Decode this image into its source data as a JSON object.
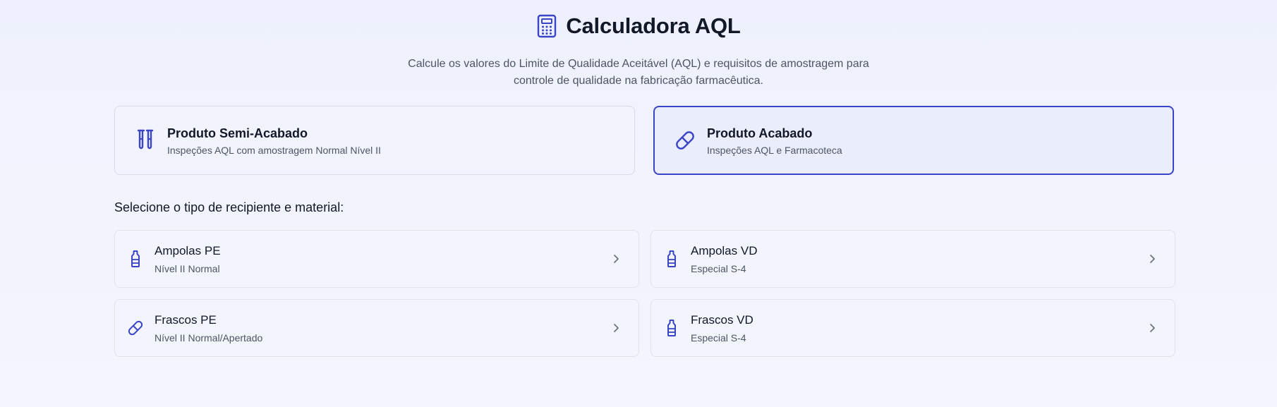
{
  "header": {
    "title": "Calculadora AQL",
    "title_icon": "calculator-icon",
    "subtitle": "Calcule os valores do Limite de Qualidade Aceitável (AQL) e requisitos de amostragem para controle de qualidade na fabricação farmacêutica."
  },
  "modes": [
    {
      "title": "Produto Semi-Acabado",
      "description": "Inspeções AQL com amostragem Normal Nível II",
      "icon": "test-tubes-icon",
      "selected": false
    },
    {
      "title": "Produto Acabado",
      "description": "Inspeções AQL e Farmacoteca",
      "icon": "pill-icon",
      "selected": true
    }
  ],
  "section": {
    "heading": "Selecione o tipo de recipiente e material:"
  },
  "containers": [
    {
      "title": "Ampolas PE",
      "description": "Nível II Normal",
      "icon": "bottle-icon"
    },
    {
      "title": "Ampolas VD",
      "description": "Especial S-4",
      "icon": "bottle-icon"
    },
    {
      "title": "Frascos PE",
      "description": "Nível II Normal/Apertado",
      "icon": "pill-icon"
    },
    {
      "title": "Frascos VD",
      "description": "Especial S-4",
      "icon": "bottle-icon"
    }
  ],
  "colors": {
    "accent": "#3a44c6",
    "background": "#eef1fd",
    "text_primary": "#111827",
    "text_secondary": "#4b5563"
  }
}
